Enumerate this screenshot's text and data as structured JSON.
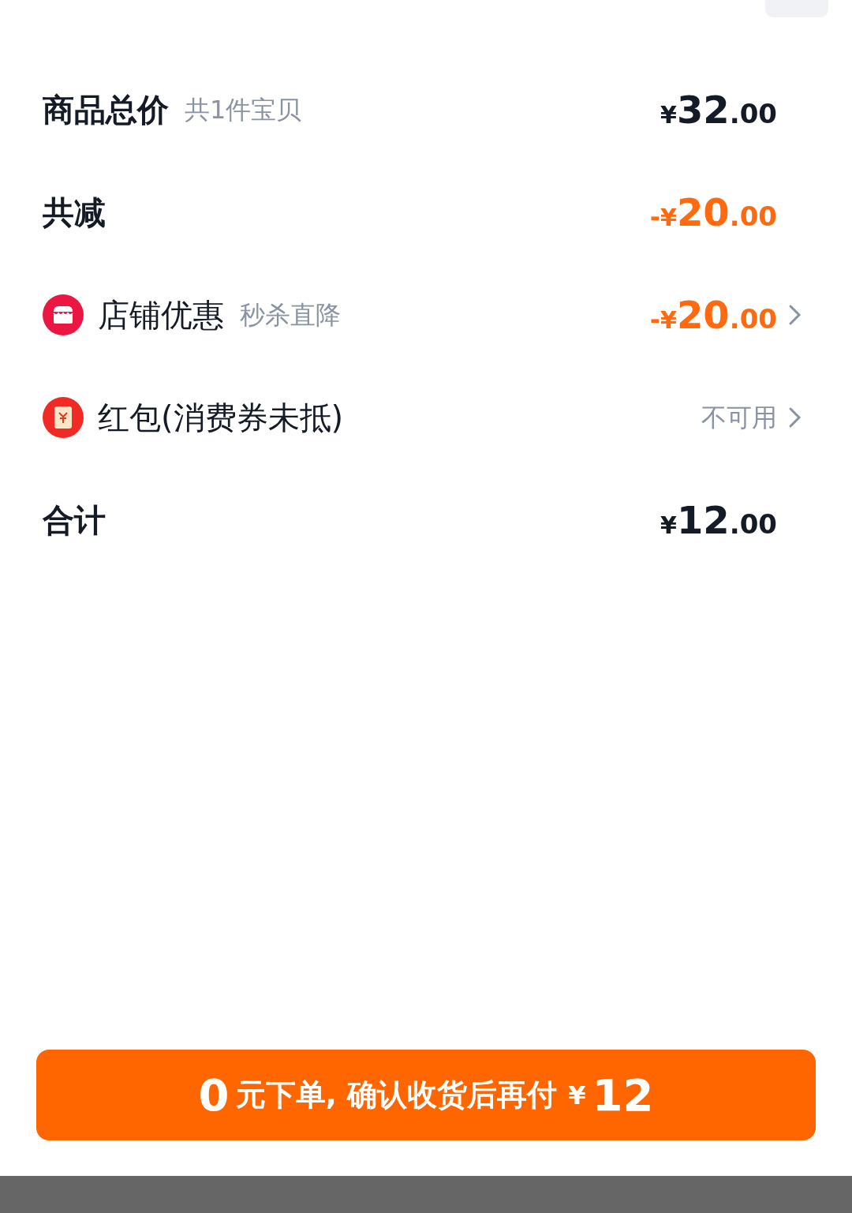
{
  "rows": [
    {
      "kind": "plain",
      "label": "商品总价",
      "note": "共1件宝贝",
      "highlight": false,
      "price": {
        "currency": "¥",
        "integer": "32",
        "decimal": ".00"
      },
      "chevron": false
    },
    {
      "kind": "plain",
      "label": "共减",
      "highlight": true,
      "price": {
        "sign": "-",
        "currency": "¥",
        "integer": "20",
        "decimal": ".00"
      },
      "chevron": false
    },
    {
      "kind": "shop",
      "label": "店铺优惠",
      "note": "秒杀直降",
      "highlight": true,
      "price": {
        "sign": "-",
        "currency": "¥",
        "integer": "20",
        "decimal": ".00"
      },
      "chevron": true
    },
    {
      "kind": "packet",
      "label": "红包(消费券未抵)",
      "status": "不可用",
      "chevron": true
    },
    {
      "kind": "plain",
      "label": "合计",
      "highlight": false,
      "price": {
        "currency": "¥",
        "integer": "12",
        "decimal": ".00"
      },
      "chevron": false
    }
  ],
  "pay_button": {
    "lead": "0",
    "text": "元下单, 确认收货后再付",
    "currency": "¥",
    "amount": "12"
  }
}
